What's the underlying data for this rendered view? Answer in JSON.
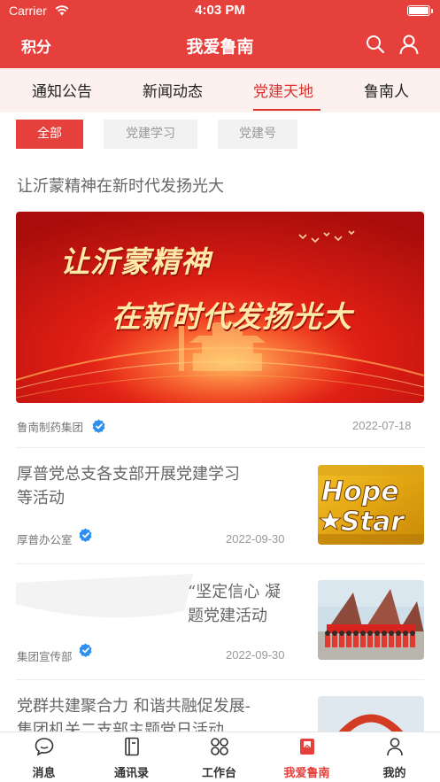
{
  "status_bar": {
    "carrier": "Carrier",
    "time": "4:03 PM"
  },
  "navbar": {
    "left_label": "积分",
    "title": "我爱鲁南"
  },
  "tabs": [
    {
      "label": "通知公告"
    },
    {
      "label": "新闻动态"
    },
    {
      "label": "党建天地",
      "active": true
    },
    {
      "label": "鲁南人"
    }
  ],
  "chips": [
    {
      "label": "全部",
      "active": true
    },
    {
      "label": "党建学习"
    },
    {
      "label": "党建号"
    }
  ],
  "featured": {
    "title": "让沂蒙精神在新时代发扬光大",
    "banner_line1": "让沂蒙精神",
    "banner_line2": "在新时代发扬光大",
    "source": "鲁南制药集团",
    "date": "2022-07-18"
  },
  "articles": [
    {
      "title_line1": "厚普党总支各支部开展党建学习",
      "title_line2": "等活动",
      "source": "厚普办公室",
      "date": "2022-09-30",
      "thumb_text_1": "Hope",
      "thumb_text_2": "Star"
    },
    {
      "title_line1": "“坚定信心  凝",
      "title_line2": "题党建活动",
      "source": "集团宣传部",
      "date": "2022-09-30"
    },
    {
      "title_line1": "党群共建聚合力  和谐共融促发展-",
      "title_line2": "集团机关二支部主题党日活动"
    }
  ],
  "tabbar": [
    {
      "label": "消息",
      "icon": "message-icon"
    },
    {
      "label": "通讯录",
      "icon": "contacts-icon"
    },
    {
      "label": "工作台",
      "icon": "workbench-icon"
    },
    {
      "label": "我爱鲁南",
      "icon": "book-icon",
      "active": true
    },
    {
      "label": "我的",
      "icon": "profile-icon"
    }
  ],
  "colors": {
    "brand_red": "#e6403c",
    "active_tab_red": "#d9332e",
    "verified_blue": "#2f8ff0"
  }
}
